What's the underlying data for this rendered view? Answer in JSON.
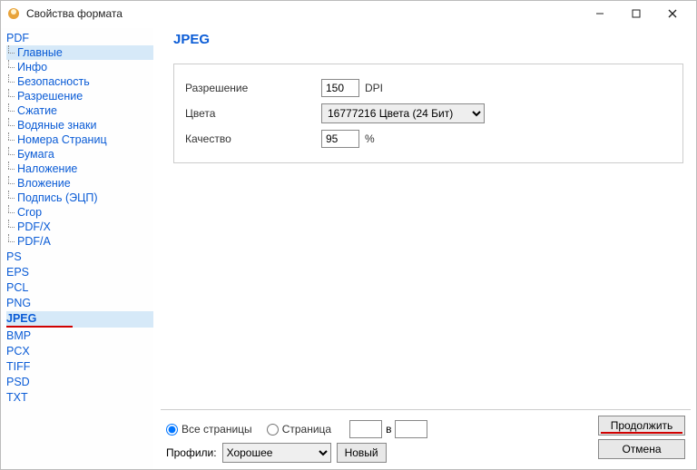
{
  "window": {
    "title": "Свойства формата"
  },
  "sidebar": {
    "pdf": {
      "label": "PDF",
      "children": [
        "Главные",
        "Инфо",
        "Безопасность",
        "Разрешение",
        "Сжатие",
        "Водяные знаки",
        "Номера Страниц",
        "Бумага",
        "Наложение",
        "Вложение",
        "Подпись  (ЭЦП)",
        "Crop",
        "PDF/X",
        "PDF/A"
      ],
      "selected_index": 0
    },
    "formats": [
      "PS",
      "EPS",
      "PCL",
      "PNG",
      "JPEG",
      "BMP",
      "PCX",
      "TIFF",
      "PSD",
      "TXT"
    ],
    "selected_format": "JPEG"
  },
  "content": {
    "heading": "JPEG",
    "resolution": {
      "label": "Разрешение",
      "value": "150",
      "unit": "DPI"
    },
    "colors": {
      "label": "Цвета",
      "value": "16777216 Цвета (24 Бит)"
    },
    "quality": {
      "label": "Качество",
      "value": "95",
      "unit": "%"
    }
  },
  "footer": {
    "all_pages": "Все страницы",
    "page": "Страница",
    "page_sep": "в",
    "profiles_label": "Профили:",
    "profile_value": "Хорошее",
    "new_btn": "Новый",
    "continue_btn": "Продолжить",
    "cancel_btn": "Отмена"
  }
}
